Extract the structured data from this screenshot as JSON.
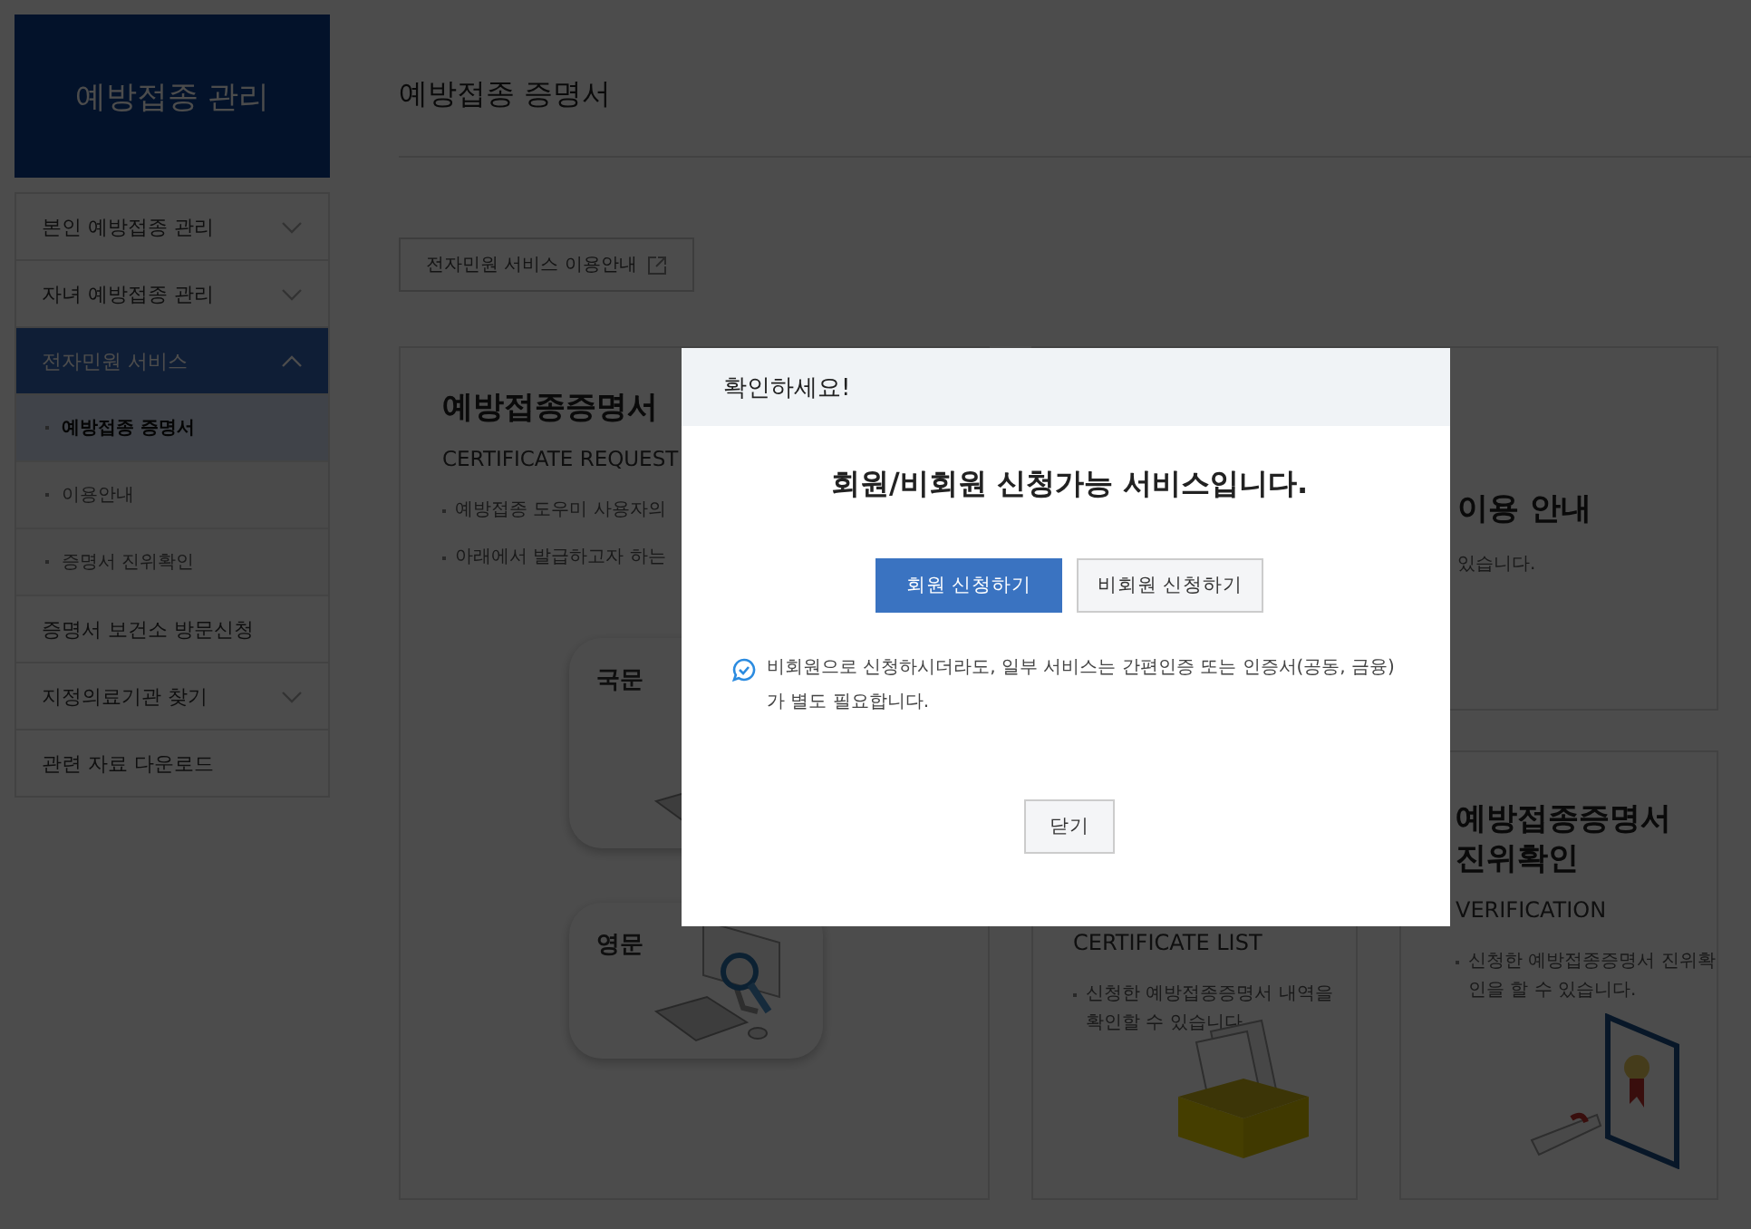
{
  "sidebar": {
    "logo": "예방접종 관리",
    "items": [
      {
        "label": "본인 예방접종 관리",
        "kind": "group",
        "selected": false,
        "expanded": false
      },
      {
        "label": "자녀 예방접종 관리",
        "kind": "group",
        "selected": false,
        "expanded": false
      },
      {
        "label": "전자민원 서비스",
        "kind": "group",
        "selected": true,
        "expanded": true,
        "children": [
          {
            "label": "예방접종 증명서",
            "selected": true
          },
          {
            "label": "이용안내",
            "selected": false
          },
          {
            "label": "증명서 진위확인",
            "selected": false
          }
        ]
      },
      {
        "label": "증명서 보건소 방문신청",
        "kind": "link",
        "selected": false
      },
      {
        "label": "지정의료기관 찾기",
        "kind": "group",
        "selected": false,
        "expanded": false
      },
      {
        "label": "관련 자료 다운로드",
        "kind": "link",
        "selected": false
      }
    ]
  },
  "page_title": "예방접종 증명서",
  "guide_link": "전자민원 서비스 이용안내",
  "request_card": {
    "title": "예방접종증명서",
    "subtitle": "CERTIFICATE REQUEST",
    "bullets": [
      "예방접종 도우미 사용자의",
      "아래에서 발급하고자 하는"
    ],
    "tiles": [
      "국문",
      "영문"
    ]
  },
  "guide_card": {
    "title": "이용 안내",
    "text": "있습니다."
  },
  "list_card": {
    "subtitle": "CERTIFICATE LIST",
    "text": "신청한 예방접종증명서 내역을 확인할 수 있습니다."
  },
  "verify_card": {
    "title": "예방접종증명서 진위확인",
    "subtitle": "VERIFICATION",
    "text": "신청한 예방접종증명서 진위확인을 할 수 있습니다."
  },
  "modal": {
    "title": "확인하세요!",
    "heading": "회원/비회원 신청가능 서비스입니다.",
    "buttons": [
      {
        "label": "회원 신청하기",
        "kind": "primary"
      },
      {
        "label": "비회원 신청하기",
        "kind": "secondary"
      }
    ],
    "note": "비회원으로 신청하시더라도, 일부 서비스는 간편인증 또는 인증서(공동, 금융)가 별도 필요합니다.",
    "close": "닫기"
  }
}
